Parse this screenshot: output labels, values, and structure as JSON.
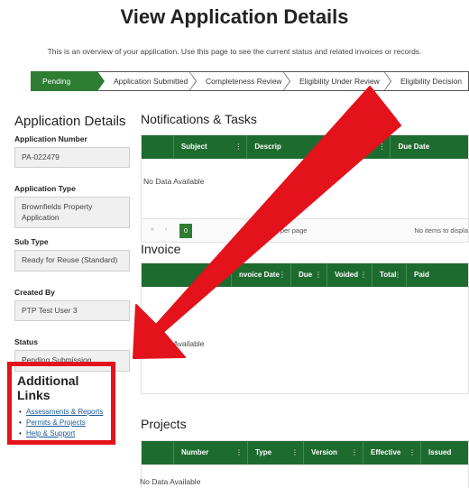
{
  "header": {
    "title": "View Application Details",
    "subtitle": "This is an overview of your application. Use this page to see the current status and related invoices or records."
  },
  "stepper": {
    "steps": [
      "Pending",
      "Application Submitted",
      "Completeness Review",
      "Eligibility Under Review",
      "Eligibility Decision"
    ],
    "active_index": 0
  },
  "sidebar": {
    "title": "Application Details",
    "fields": {
      "application_number": {
        "label": "Application Number",
        "value": "PA-022479"
      },
      "application_type": {
        "label": "Application Type",
        "value": "Brownfields Property Application"
      },
      "sub_type": {
        "label": "Sub Type",
        "value": "Ready for Reuse (Standard)"
      },
      "created_by": {
        "label": "Created By",
        "value": "PTP Test User 3"
      },
      "status": {
        "label": "Status",
        "value": "Pending Submission"
      }
    }
  },
  "additional_links": {
    "title": "Additional Links",
    "links": [
      "Assessments & Reports",
      "Permits & Projects",
      "Help & Support"
    ]
  },
  "notifications": {
    "title": "Notifications & Tasks",
    "columns": [
      "Subject",
      "Descrip",
      "",
      "Due Date"
    ],
    "empty_text": "No Data Available",
    "pager": {
      "first": "«",
      "prev": "‹",
      "page": "0",
      "per_page": "s per page",
      "no_items": "No items to displa"
    }
  },
  "invoices": {
    "title": "Invoice",
    "columns": [
      "",
      "nvoice Date",
      "Due",
      "Voided",
      "Total",
      "Paid"
    ],
    "empty_text": "Data Available",
    "empty_prefix": "No"
  },
  "projects": {
    "title": "Projects",
    "columns": [
      "Number",
      "Type",
      "Version",
      "Effective",
      "Issued"
    ],
    "empty_text": "No Data Available"
  },
  "icons": {
    "kebab": "⋮",
    "overlay": "red-arrow-annotation"
  },
  "colors": {
    "accent_green": "#1e6b2f",
    "annotation_red": "#e3121b",
    "link_blue": "#1a5a9a"
  }
}
